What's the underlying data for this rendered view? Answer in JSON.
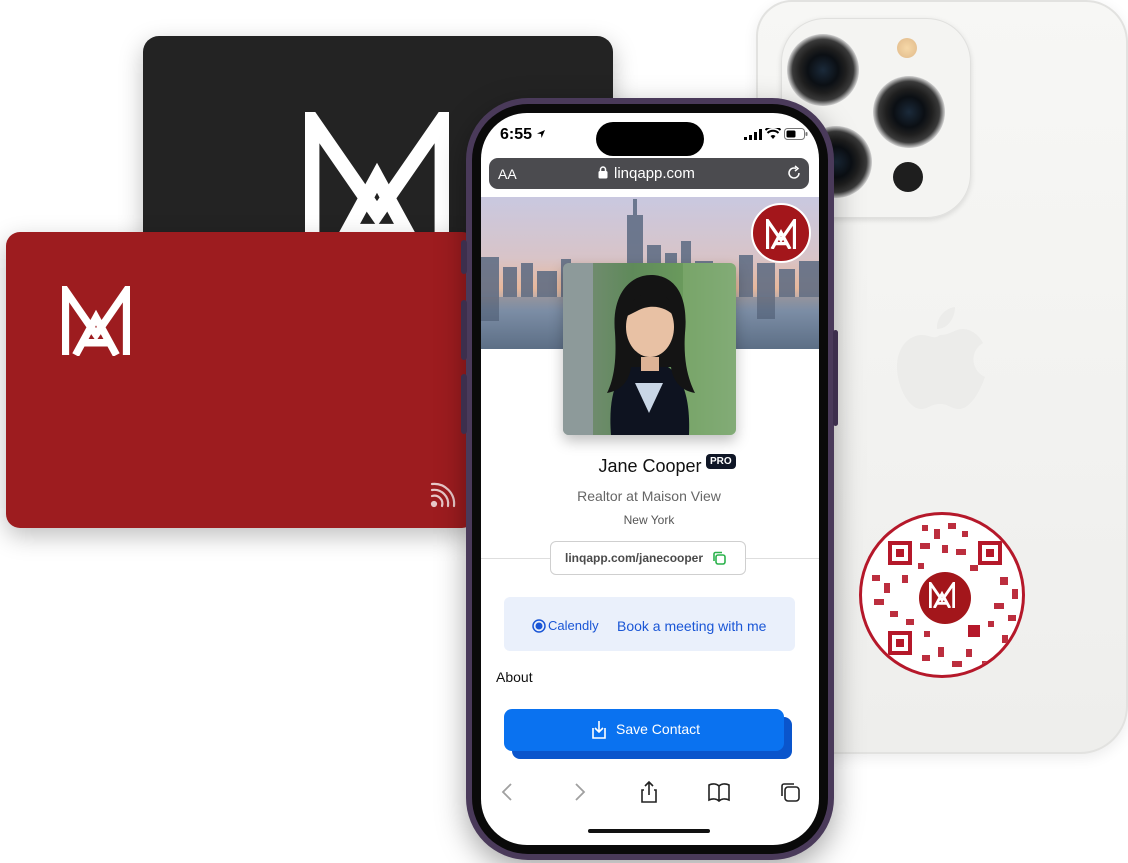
{
  "phone": {
    "time": "6:55",
    "url": "linqapp.com",
    "text_size_label": "AA"
  },
  "profile": {
    "name": "Jane Cooper",
    "badge": "PRO",
    "title": "Realtor at Maison View",
    "location": "New York",
    "link": "linqapp.com/janecooper"
  },
  "calendly": {
    "brand": "Calendly",
    "label": "Book a meeting with me"
  },
  "about_label": "About",
  "save_contact_label": "Save Contact",
  "colors": {
    "brand_red": "#a3161b",
    "card_black": "#232323",
    "button_blue": "#0a72f0",
    "calendly_blue": "#1a56d6"
  },
  "toolbar": {
    "icons": [
      "back-icon",
      "forward-icon",
      "share-icon",
      "bookmarks-icon",
      "tabs-icon"
    ]
  }
}
